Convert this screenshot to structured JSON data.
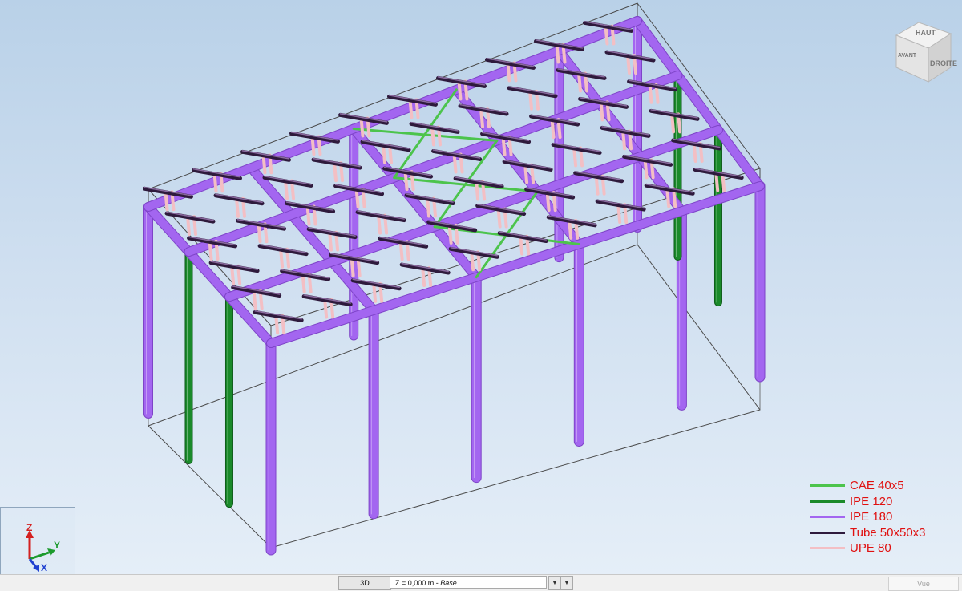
{
  "viewport": {
    "background_top": "#b9d1e8",
    "background_bottom": "#e6eff8"
  },
  "legend": [
    {
      "label": "CAE 40x5",
      "color": "#4cc44c"
    },
    {
      "label": "IPE 120",
      "color": "#1a8a2a"
    },
    {
      "label": "IPE 180",
      "color": "#a366f0"
    },
    {
      "label": "Tube 50x50x3",
      "color": "#2e1a3c"
    },
    {
      "label": "UPE 80",
      "color": "#f3bfc4"
    }
  ],
  "axes": {
    "z": "Z",
    "y": "Y",
    "x": "X"
  },
  "view_cube": {
    "top": "HAUT",
    "front": "DROITE",
    "left": "AVANT"
  },
  "statusbar": {
    "view_tab": "3D",
    "level_prefix": "Z = 0,000 m - ",
    "level_name": "Base",
    "vue_label": "Vue"
  },
  "icons": {
    "dropdown": "dropdown-arrow-icon",
    "scroll_down": "scroll-down-arrow-icon"
  }
}
